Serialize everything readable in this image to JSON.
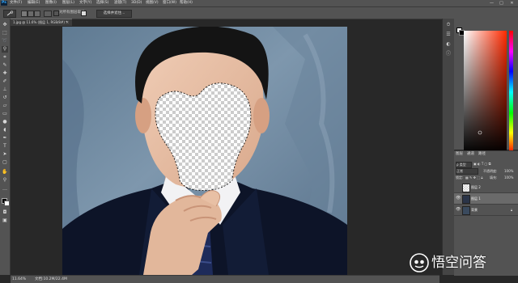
{
  "menubar": {
    "logo": "Ps",
    "items": [
      "文件(F)",
      "编辑(E)",
      "图像(I)",
      "图层(L)",
      "文字(Y)",
      "选择(S)",
      "滤镜(T)",
      "3D(D)",
      "视图(V)",
      "窗口(W)",
      "帮助(H)"
    ],
    "window_controls": [
      "—",
      "□",
      "✕"
    ]
  },
  "options_bar": {
    "sample_all_layers": "对所有图层取样",
    "auto_enhance": "自动增强",
    "select_subject": "选择并遮住..."
  },
  "document": {
    "tab_title": "1.jpg @ 11.6% (图层 1, RGB/8#) *",
    "tab_close": "×"
  },
  "status_bar": {
    "zoom": "11.64%",
    "doc_size": "文档:10.2M/22.4M"
  },
  "panels": {
    "color_tabs": [
      "颜色",
      "色板"
    ],
    "layers_tabs": [
      "图层",
      "通道",
      "路径"
    ],
    "filter_kind": "ρ 类型",
    "blend_mode": "正常",
    "opacity_label": "不透明度:",
    "opacity_value": "100%",
    "lock_label": "锁定:",
    "fill_label": "填充:",
    "fill_value": "100%",
    "layers": [
      {
        "name": "图层 2",
        "visible": false,
        "selected": false
      },
      {
        "name": "图层 1",
        "visible": true,
        "selected": true
      },
      {
        "name": "背景",
        "visible": true,
        "selected": false,
        "locked": true
      }
    ]
  },
  "icons": {
    "move": "move-icon",
    "marquee": "marquee-icon",
    "lasso": "lasso-icon",
    "quick-select": "quick-select-icon",
    "crop": "crop-icon",
    "eyedropper": "eyedropper-icon",
    "healing": "healing-brush-icon",
    "brush": "brush-icon",
    "stamp": "clone-stamp-icon",
    "history": "history-brush-icon",
    "eraser": "eraser-icon",
    "gradient": "gradient-icon",
    "blur": "blur-icon",
    "dodge": "dodge-icon",
    "pen": "pen-icon",
    "type": "type-icon",
    "path": "path-select-icon",
    "shape": "rectangle-icon",
    "hand": "hand-icon",
    "zoom": "zoom-icon"
  },
  "watermark": {
    "text": "悟空问答"
  },
  "colors": {
    "ui_dark": "#535353",
    "canvas_bg": "#282828",
    "photo_bg": "#6f8aa3",
    "suit": "#0d1428",
    "selected_layer": "#6a6a6a"
  }
}
